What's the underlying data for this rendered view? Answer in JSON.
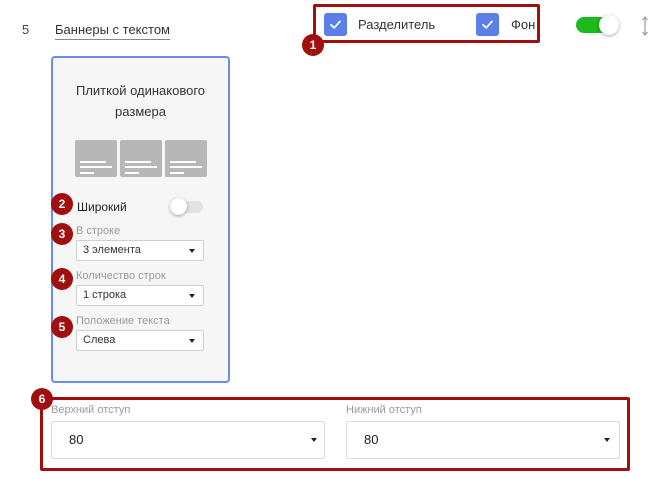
{
  "row": {
    "number": "5",
    "title": "Баннеры с текстом"
  },
  "options": {
    "separator": {
      "label": "Разделитель",
      "checked": true
    },
    "background": {
      "label": "Фон",
      "checked": true
    },
    "enabled": true
  },
  "badges": [
    "1",
    "2",
    "3",
    "4",
    "5",
    "6"
  ],
  "card": {
    "title_line1": "Плиткой одинакового",
    "title_line2": "размера",
    "thumbnail_count": 3,
    "wide": {
      "label": "Широкий",
      "on": false
    },
    "per_row": {
      "label": "В строке",
      "value": "3 элемента"
    },
    "rows": {
      "label": "Количество строк",
      "value": "1 строка"
    },
    "text_position": {
      "label": "Положение текста",
      "value": "Слева"
    }
  },
  "spacing": {
    "top": {
      "label": "Верхний отступ",
      "value": "80"
    },
    "bottom": {
      "label": "Нижний отступ",
      "value": "80"
    }
  },
  "colors": {
    "accent_red": "#a00e0e",
    "checkbox_blue": "#5b7fe8",
    "toggle_green": "#1db91d",
    "card_border": "#6b8de8"
  }
}
